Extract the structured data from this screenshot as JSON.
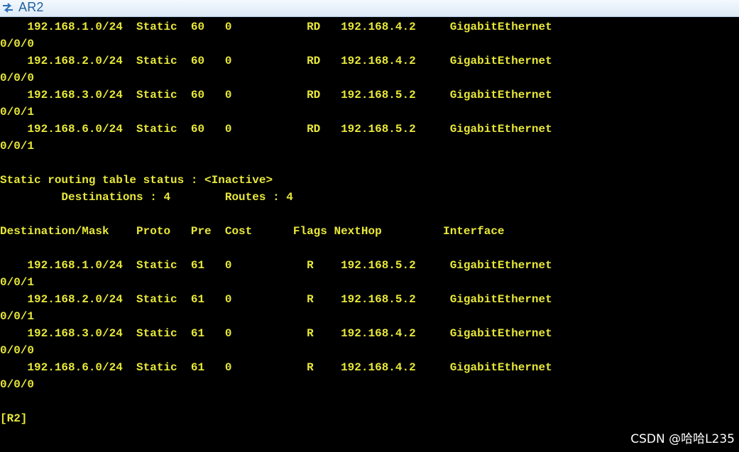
{
  "window": {
    "title": "AR2",
    "icon": "router-network-icon"
  },
  "terminal": {
    "lines": [
      "    192.168.1.0/24  Static  60   0           RD   192.168.4.2     GigabitEthernet",
      "0/0/0",
      "    192.168.2.0/24  Static  60   0           RD   192.168.4.2     GigabitEthernet",
      "0/0/0",
      "    192.168.3.0/24  Static  60   0           RD   192.168.5.2     GigabitEthernet",
      "0/0/1",
      "    192.168.6.0/24  Static  60   0           RD   192.168.5.2     GigabitEthernet",
      "0/0/1",
      "",
      "Static routing table status : <Inactive>",
      "         Destinations : 4        Routes : 4",
      "",
      "Destination/Mask    Proto   Pre  Cost      Flags NextHop         Interface",
      "",
      "    192.168.1.0/24  Static  61   0           R    192.168.5.2     GigabitEthernet",
      "0/0/1",
      "    192.168.2.0/24  Static  61   0           R    192.168.5.2     GigabitEthernet",
      "0/0/1",
      "    192.168.3.0/24  Static  61   0           R    192.168.4.2     GigabitEthernet",
      "0/0/0",
      "    192.168.6.0/24  Static  61   0           R    192.168.4.2     GigabitEthernet",
      "0/0/0",
      "",
      "[R2]"
    ],
    "text_color": "#e8e83a",
    "background": "#000000"
  },
  "watermark": {
    "text": "CSDN @哈哈L235"
  }
}
